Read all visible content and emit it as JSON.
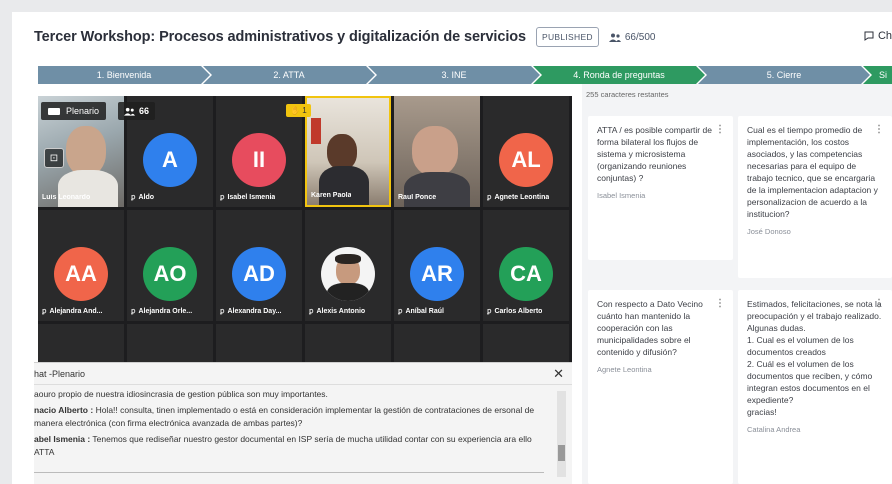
{
  "header": {
    "title": "Tercer Workshop: Procesos administrativos y digitalización de servicios",
    "status": "PUBLISHED",
    "participants": "66/500",
    "chat_link": "Ch"
  },
  "stages": [
    {
      "label": "1. Bienvenida"
    },
    {
      "label": "2. ATTA"
    },
    {
      "label": "3. INE"
    },
    {
      "label": "4. Ronda de preguntas"
    },
    {
      "label": "5. Cierre"
    },
    {
      "label": "Si"
    }
  ],
  "video": {
    "room_label": "Plenario",
    "count": "66",
    "hand": "1",
    "tiles": [
      {
        "name": "Luis Leonardo",
        "type": "cam",
        "muted": false
      },
      {
        "name": "Aldo",
        "initials": "A",
        "color": "#2f80ed",
        "muted": true
      },
      {
        "name": "Isabel Ismenia",
        "initials": "II",
        "color": "#e74c5e",
        "muted": true
      },
      {
        "name": "Karen Paola",
        "type": "cam",
        "muted": false
      },
      {
        "name": "Raul Ponce",
        "type": "cam",
        "muted": false
      },
      {
        "name": "Agnete Leontina",
        "initials": "AL",
        "color": "#f0654a",
        "muted": true
      },
      {
        "name": "Alejandra And...",
        "initials": "AA",
        "color": "#f0654a",
        "muted": true
      },
      {
        "name": "Alejandra Orle...",
        "initials": "AO",
        "color": "#23a058",
        "muted": true
      },
      {
        "name": "Alexandra Day...",
        "initials": "AD",
        "color": "#2f80ed",
        "muted": true
      },
      {
        "name": "Alexis Antonio",
        "type": "photo",
        "muted": true
      },
      {
        "name": "Aníbal Raúl",
        "initials": "AR",
        "color": "#2f80ed",
        "muted": true
      },
      {
        "name": "Carlos Alberto",
        "initials": "CA",
        "color": "#23a058",
        "muted": true
      }
    ]
  },
  "chat": {
    "title": "hat -Plenario",
    "close": "✕",
    "messages": [
      {
        "author": "",
        "text": "aouro propio de nuestra idiosincrasia de gestion pública son muy importantes."
      },
      {
        "author": "nacio Alberto :",
        "text": " Hola!! consulta, tinen implementado o está en consideración implementar la gestión de contrataciones de ersonal de manera electrónica (con firma electrónica avanzada de ambas partes)?"
      },
      {
        "author": "abel Ismenia :",
        "text": " Tenemos que rediseñar nuestro gestor documental en ISP sería de mucha utilidad contar con su experiencia ara ello ATTA"
      }
    ]
  },
  "qa": {
    "remaining": "255 caracteres restantes",
    "cards": [
      {
        "text": "ATTA / es posible compartir de forma bilateral los flujos de sistema y microsistema (organizando reuniones conjuntas) ?",
        "author": "Isabel Ismenia"
      },
      {
        "text": "Cual es el tiempo promedio de implementación, los costos asociados, y las competencias necesarias para el equipo de trabajo tecnico, que se encargaria de la implementacion adaptacion y personalizacion de acuerdo a la institucion?",
        "author": "José Donoso"
      },
      {
        "text": "Con respecto a Dato Vecino cuánto han mantenido la cooperación con las municipalidades sobre el contenido y difusión?",
        "author": "Agnete Leontina"
      },
      {
        "text": "Estimados, felicitaciones, se nota la preocupación y el trabajo realizado. Algunas dudas.\n1. Cual es el volumen de los documentos creados\n2. Cuál es el volumen de los documentos que reciben, y cómo integran estos documentos en el expediente?\ngracias!",
        "author": "Catalina Andrea"
      }
    ]
  },
  "colors": {
    "stage": "#6f8fa6",
    "stage_active": "#2e9a61"
  }
}
